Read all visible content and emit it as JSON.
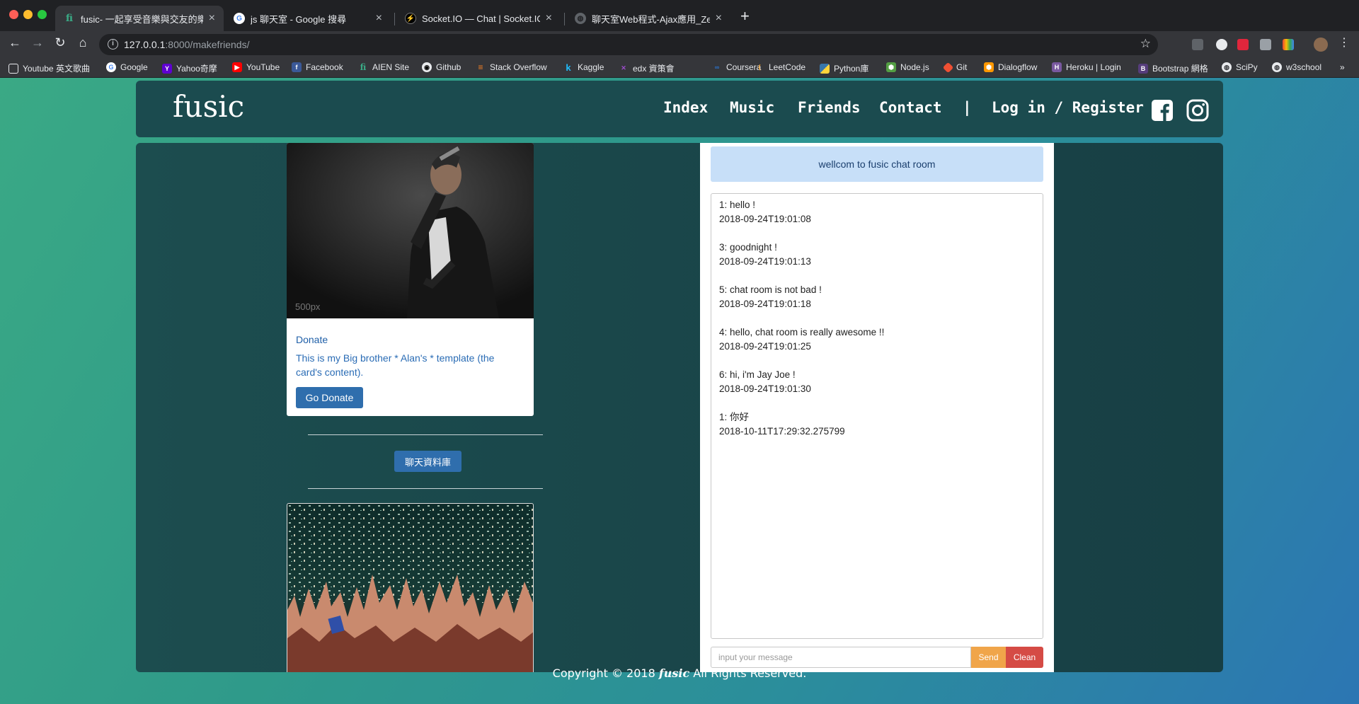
{
  "browser": {
    "tabs": [
      {
        "title": "fusic- 一起享受音樂與交友的樂趣",
        "active": true
      },
      {
        "title": "js 聊天室 - Google 搜尋",
        "active": false
      },
      {
        "title": "Socket.IO — Chat | Socket.IO",
        "active": false
      },
      {
        "title": "聊天室Web程式-Ajax應用_ZenD",
        "active": false
      }
    ],
    "url_host": "127.0.0.1",
    "url_path": ":8000/makefriends/",
    "bookmarks": [
      "Youtube 英文歌曲",
      "Google",
      "Yahoo奇摩",
      "YouTube",
      "Facebook",
      "AIEN Site",
      "Github",
      "Stack Overflow",
      "Kaggle",
      "edx 資策會",
      "Coursera",
      "LeetCode",
      "Python庫",
      "Node.js",
      "Git",
      "Dialogflow",
      "Heroku | Login",
      "Bootstrap 網格",
      "SciPy",
      "w3school"
    ],
    "bookmarks_more": "»"
  },
  "site": {
    "logo": "fusic",
    "nav": {
      "index": "Index",
      "music": "Music",
      "friends": "Friends",
      "contact": "Contact",
      "divider": "|",
      "login": "Log in / Register"
    }
  },
  "card": {
    "image_watermark": "500px",
    "title": "Donate",
    "text": "This is my Big brother * Alan's * template (the card's content).",
    "button": "Go Donate"
  },
  "chat_db_button": "聊天資料庫",
  "chat": {
    "header": "wellcom to fusic chat room",
    "messages": [
      {
        "text": "1: hello !",
        "time": "2018-09-24T19:01:08"
      },
      {
        "text": "3: goodnight !",
        "time": "2018-09-24T19:01:13"
      },
      {
        "text": "5: chat room is not bad !",
        "time": "2018-09-24T19:01:18"
      },
      {
        "text": "4: hello, chat room is really awesome !!",
        "time": "2018-09-24T19:01:25"
      },
      {
        "text": "6: hi, i'm Jay Joe !",
        "time": "2018-09-24T19:01:30"
      },
      {
        "text": "1: 你好",
        "time": "2018-10-11T17:29:32.275799"
      }
    ],
    "input_placeholder": "input your message",
    "send": "Send",
    "clean": "Clean"
  },
  "footer": {
    "prefix": "Copyright © 2018",
    "brand": "fusic",
    "suffix": "All Rights Reserved."
  },
  "colors": {
    "nav_bg": "#1b4b4f",
    "chat_header_bg": "#c7dff8",
    "send": "#f0a54a",
    "clean": "#d54b45",
    "primary_button": "#2f6ead"
  }
}
